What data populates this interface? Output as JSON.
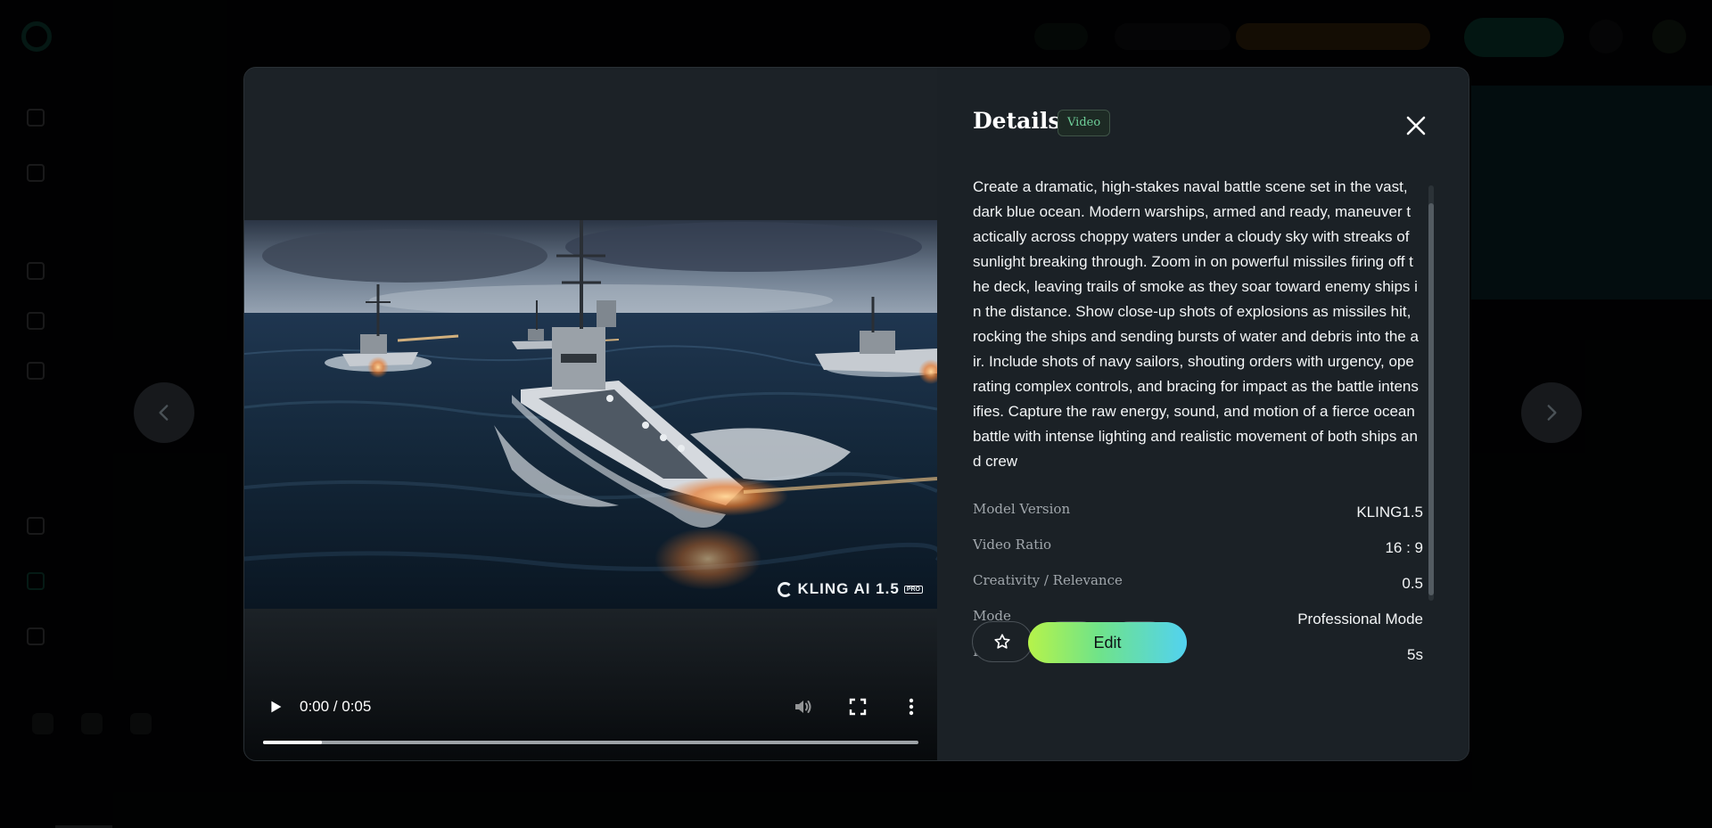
{
  "background_app": {
    "sidebar_items": [
      "",
      "",
      "",
      "",
      "",
      "",
      "",
      ""
    ]
  },
  "modal": {
    "video": {
      "time_display": "0:00 / 0:05",
      "progress_fraction": 0.09,
      "watermark": "KLING AI 1.5",
      "watermark_tag": "PRO"
    },
    "details": {
      "title": "Details",
      "badge": "Video",
      "prompt": "Create a dramatic, high-stakes naval battle scene set in the vast, dark blue ocean. Modern warships, armed and ready, maneuver tactically across choppy waters under a cloudy sky with streaks of sunlight breaking through. Zoom in on powerful missiles firing off the deck, leaving trails of smoke as they soar toward enemy ships in the distance. Show close-up shots of explosions as missiles hit, rocking the ships and sending bursts of water and debris into the air. Include shots of navy sailors, shouting orders with urgency, operating complex controls, and bracing for impact as the battle intensifies. Capture the raw energy, sound, and motion of a fierce ocean battle with intense lighting and realistic movement of both ships and crew",
      "meta": [
        {
          "key": "Model Version",
          "value": "KLING1.5"
        },
        {
          "key": "Video Ratio",
          "value": "16 : 9"
        },
        {
          "key": "Creativity / Relevance",
          "value": "0.5"
        },
        {
          "key": "Mode",
          "value": "Professional Mode"
        },
        {
          "key": "Length",
          "value": "5s"
        }
      ],
      "edit_label": "Edit"
    }
  },
  "icons": {
    "prev": "chevron-left-icon",
    "next": "chevron-right-icon",
    "close": "close-icon",
    "favorite": "star-icon",
    "download": "download-icon",
    "more": "more-horizontal-icon",
    "play": "play-icon",
    "volume": "volume-icon",
    "fullscreen": "fullscreen-icon",
    "video_menu": "more-vertical-icon"
  },
  "colors": {
    "accent": "#6fd09a",
    "edit_gradient_start": "#b6f34a",
    "edit_gradient_end": "#52d2f0"
  }
}
